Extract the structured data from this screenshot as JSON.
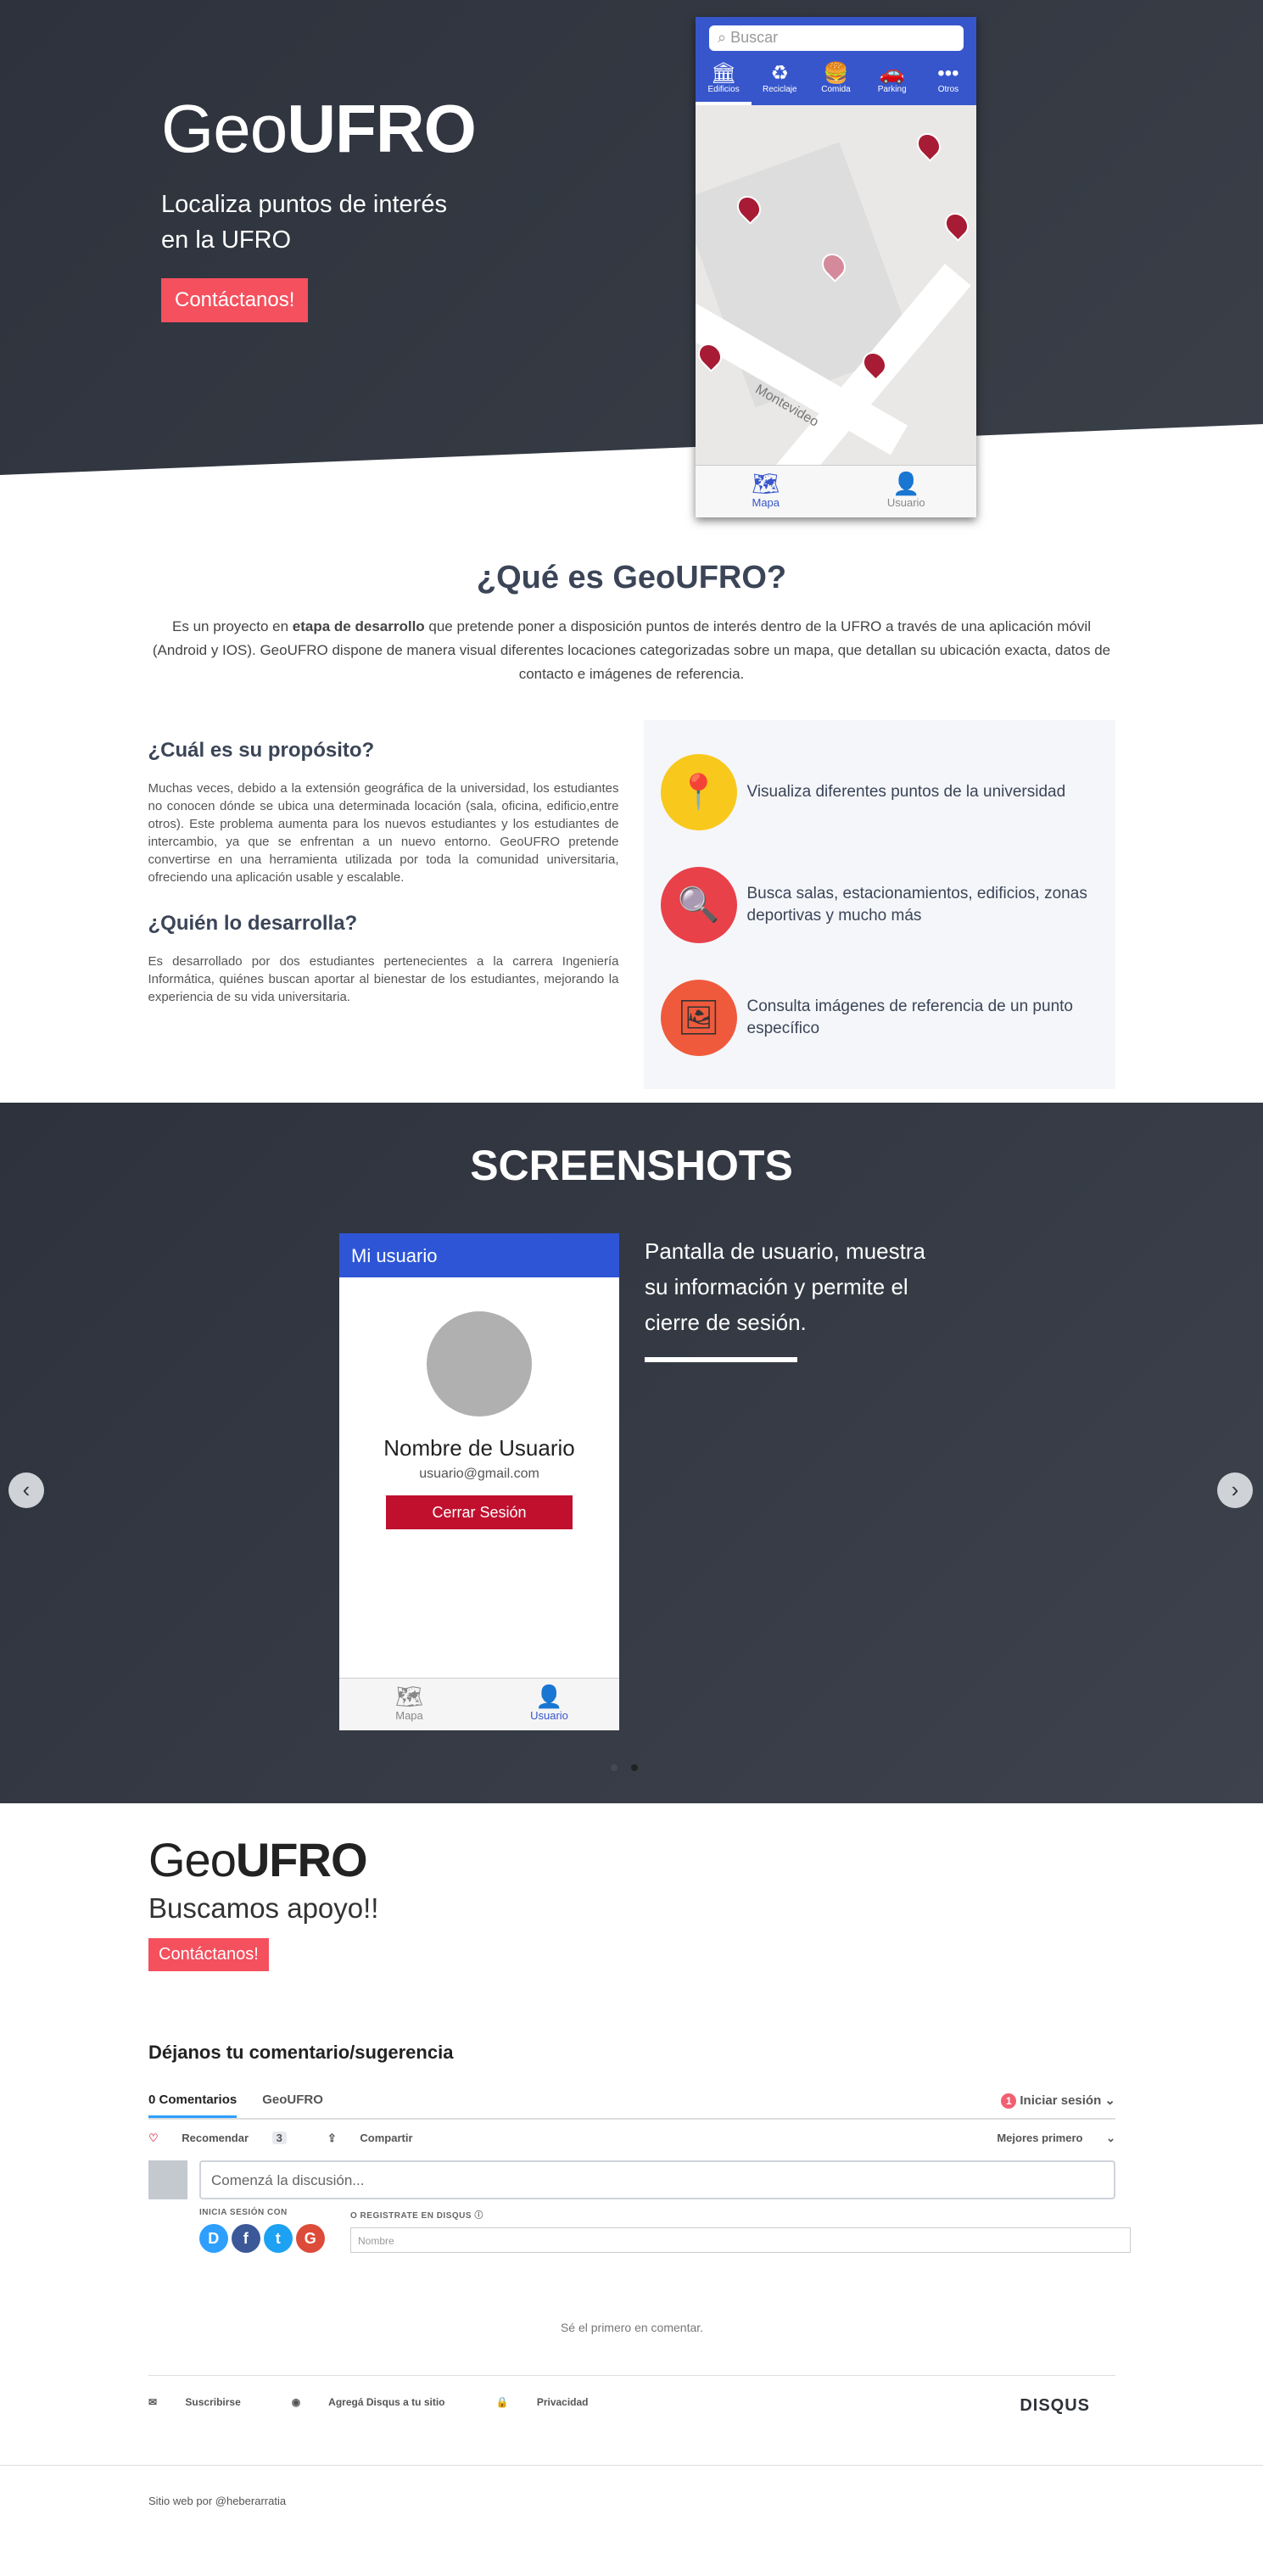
{
  "hero": {
    "brand_light": "Geo",
    "brand_bold": "UFRO",
    "tagline": "Localiza puntos de interés en la UFRO",
    "cta": "Contáctanos!"
  },
  "phone": {
    "search_placeholder": "Buscar",
    "tabs": [
      {
        "label": "Edificios",
        "icon": "building-icon",
        "glyph": "🏛"
      },
      {
        "label": "Reciclaje",
        "icon": "recycle-icon",
        "glyph": "♻"
      },
      {
        "label": "Comida",
        "icon": "burger-icon",
        "glyph": "🍔"
      },
      {
        "label": "Parking",
        "icon": "car-icon",
        "glyph": "🚗"
      },
      {
        "label": "Otros",
        "icon": "more-icon",
        "glyph": "•••"
      }
    ],
    "street": "Montevideo",
    "bottom_tabs": [
      {
        "label": "Mapa",
        "icon": "map-icon",
        "glyph": "🗺"
      },
      {
        "label": "Usuario",
        "icon": "user-icon",
        "glyph": "👤"
      }
    ]
  },
  "about": {
    "title": "¿Qué es GeoUFRO?",
    "lead_pre": "Es un proyecto en ",
    "lead_bold": "etapa de desarrollo",
    "lead_post": " que pretende poner a disposición puntos de interés dentro de la UFRO a través de una aplicación móvil (Android y IOS). GeoUFRO dispone de manera visual diferentes locaciones categorizadas sobre un mapa, que detallan su ubicación exacta, datos de contacto e imágenes de referencia.",
    "purpose_title": "¿Cuál es su propósito?",
    "purpose_text": "Muchas veces, debido a la extensión geográfica de la universidad, los estudiantes no conocen dónde se ubica una determinada locación (sala, oficina, edificio,entre otros). Este problema aumenta para los nuevos estudiantes y los estudiantes de intercambio, ya que se enfrentan a un nuevo entorno. GeoUFRO pretende convertirse en una herramienta utilizada por toda la comunidad universitaria, ofreciendo una aplicación usable y escalable.",
    "who_title": "¿Quién lo desarrolla?",
    "who_text": "Es desarrollado por dos estudiantes pertenecientes a la carrera Ingeniería Informática, quiénes buscan aportar al bienestar de los estudiantes, mejorando la experiencia de su vida universitaria.",
    "features": [
      {
        "text": "Visualiza diferentes puntos de la universidad",
        "icon": "map-pin-icon",
        "glyph": "📍",
        "color": "#f8c81c"
      },
      {
        "text": "Busca salas, estacionamientos, edificios, zonas deportivas y mucho más",
        "icon": "magnifier-icon",
        "glyph": "🔍",
        "color": "#e8414a"
      },
      {
        "text": "Consulta imágenes de referencia de un punto específico",
        "icon": "picture-icon",
        "glyph": "🖼",
        "color": "#ef5a3c"
      }
    ]
  },
  "screenshots": {
    "title": "SCREENSHOTS",
    "header": "Mi usuario",
    "username": "Nombre de Usuario",
    "email": "usuario@gmail.com",
    "logout": "Cerrar Sesión",
    "tab_map": "Mapa",
    "tab_user": "Usuario",
    "caption": "Pantalla de usuario, muestra su información y permite el cierre de sesión.",
    "prev": "‹",
    "next": "›"
  },
  "cta": {
    "brand_light": "Geo",
    "brand_bold": "UFRO",
    "subtitle": "Buscamos apoyo!!",
    "button": "Contáctanos!"
  },
  "comments": {
    "title": "Déjanos tu comentario/sugerencia",
    "tab_comments": "0 Comentarios",
    "tab_site": "GeoUFRO",
    "login": "Iniciar sesión",
    "login_badge": "1",
    "recommend": "Recomendar",
    "recommend_count": "3",
    "share": "Compartir",
    "sort": "Mejores primero",
    "placeholder": "Comenzá la discusión...",
    "login_with": "INICIA SESIÓN CON",
    "register": "O REGISTRATE EN DISQUS",
    "name_placeholder": "Nombre",
    "empty": "Sé el primero en comentar.",
    "subscribe": "Suscribirse",
    "add_disqus": "Agregá Disqus a tu sitio",
    "privacy": "Privacidad",
    "logo": "DISQUS"
  },
  "footer": {
    "credit": "Sitio web por @heberarratia"
  }
}
